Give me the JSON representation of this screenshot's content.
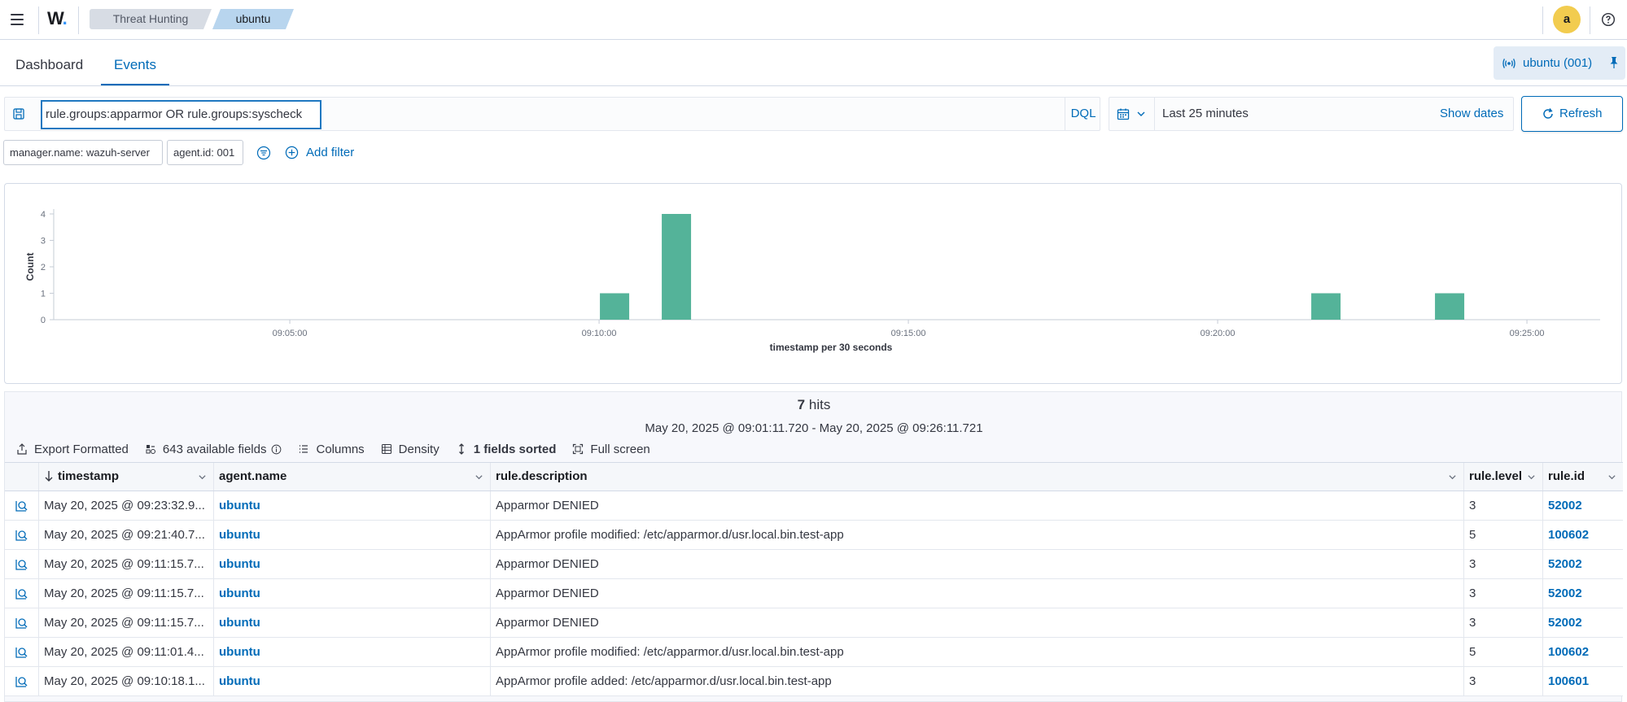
{
  "header": {
    "logo_text": "W",
    "logo_dot": ".",
    "breadcrumbs": [
      "Threat Hunting",
      "ubuntu"
    ],
    "avatar_initial": "a"
  },
  "tabs": [
    "Dashboard",
    "Events"
  ],
  "agent_pill": "ubuntu (001)",
  "query": {
    "value": "rule.groups:apparmor OR rule.groups:syscheck",
    "language": "DQL"
  },
  "time": {
    "range": "Last 25 minutes",
    "show_dates": "Show dates",
    "refresh": "Refresh"
  },
  "filters": [
    "manager.name: wazuh-server",
    "agent.id: 001"
  ],
  "add_filter": "Add filter",
  "chart_data": {
    "type": "bar",
    "ylabel": "Count",
    "xlabel": "timestamp per 30 seconds",
    "yticks": [
      "0",
      "1",
      "2",
      "3",
      "4"
    ],
    "xticks": [
      "09:05:00",
      "09:10:00",
      "09:15:00",
      "09:20:00",
      "09:25:00"
    ],
    "ylim": [
      0,
      4
    ],
    "x": [
      "09:10:00",
      "09:11:00",
      "09:21:30",
      "09:23:30"
    ],
    "values": [
      1,
      4,
      1,
      1
    ],
    "bar_color": "#54b399"
  },
  "results": {
    "hits_count": "7",
    "hits_label": "hits",
    "range": "May 20, 2025 @ 09:01:11.720 - May 20, 2025 @ 09:26:11.721",
    "toolbar": {
      "export": "Export Formatted",
      "fields": "643 available fields",
      "columns": "Columns",
      "density": "Density",
      "sorted": "1 fields sorted",
      "fullscreen": "Full screen"
    },
    "columns": [
      "timestamp",
      "agent.name",
      "rule.description",
      "rule.level",
      "rule.id"
    ],
    "rows": [
      {
        "timestamp": "May 20, 2025 @ 09:23:32.9...",
        "agent": "ubuntu",
        "description": "Apparmor DENIED",
        "level": "3",
        "id": "52002"
      },
      {
        "timestamp": "May 20, 2025 @ 09:21:40.7...",
        "agent": "ubuntu",
        "description": "AppArmor profile modified: /etc/apparmor.d/usr.local.bin.test-app",
        "level": "5",
        "id": "100602"
      },
      {
        "timestamp": "May 20, 2025 @ 09:11:15.7...",
        "agent": "ubuntu",
        "description": "Apparmor DENIED",
        "level": "3",
        "id": "52002"
      },
      {
        "timestamp": "May 20, 2025 @ 09:11:15.7...",
        "agent": "ubuntu",
        "description": "Apparmor DENIED",
        "level": "3",
        "id": "52002"
      },
      {
        "timestamp": "May 20, 2025 @ 09:11:15.7...",
        "agent": "ubuntu",
        "description": "Apparmor DENIED",
        "level": "3",
        "id": "52002"
      },
      {
        "timestamp": "May 20, 2025 @ 09:11:01.4...",
        "agent": "ubuntu",
        "description": "AppArmor profile modified: /etc/apparmor.d/usr.local.bin.test-app",
        "level": "5",
        "id": "100602"
      },
      {
        "timestamp": "May 20, 2025 @ 09:10:18.1...",
        "agent": "ubuntu",
        "description": "AppArmor profile added: /etc/apparmor.d/usr.local.bin.test-app",
        "level": "3",
        "id": "100601"
      }
    ]
  },
  "colors": {
    "accent": "#006bb8",
    "bar": "#54b399",
    "avatar": "#f2cc4f",
    "breadcrumb_active": "#b8d5ee"
  },
  "icons": {
    "menu": "hamburger-icon",
    "help": "help-icon",
    "agent": "antenna-icon",
    "pin": "pin-icon",
    "save": "save-query-icon",
    "calendar": "calendar-icon",
    "refresh": "refresh-icon",
    "filter_menu": "filter-menu-icon",
    "add": "plus-circle-icon",
    "expand": "expand-document-icon"
  }
}
